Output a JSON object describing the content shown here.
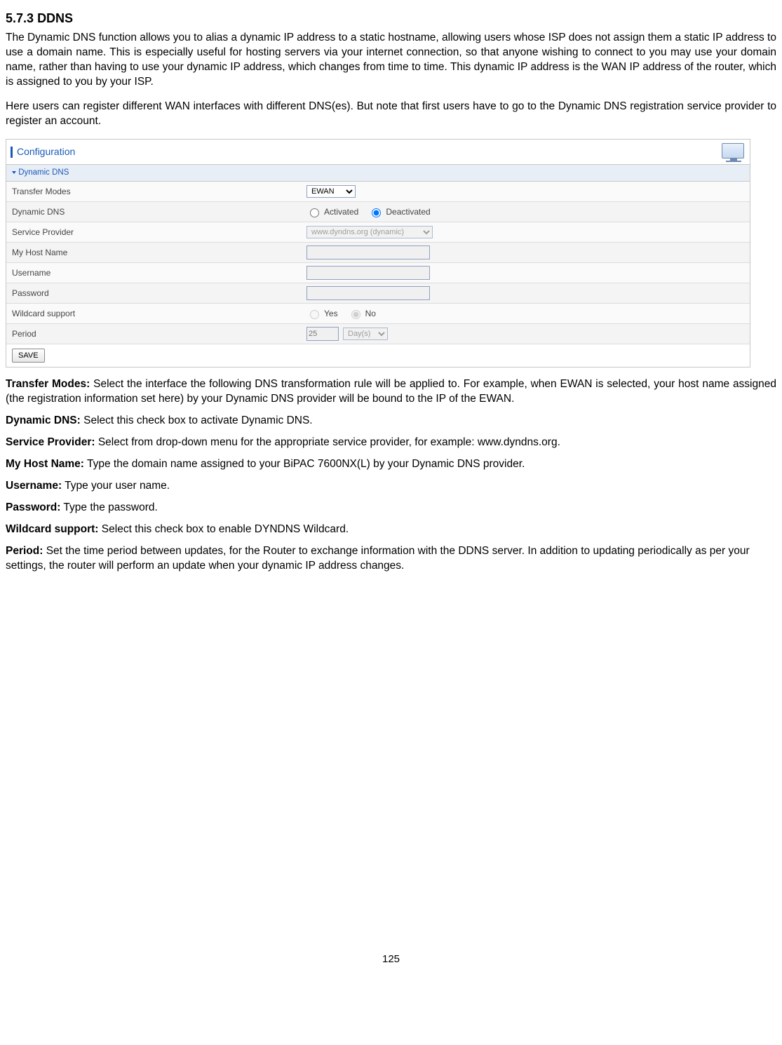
{
  "section": {
    "number": "5.7.3",
    "title": "DDNS"
  },
  "intro_para1": "The Dynamic DNS function allows you to alias a dynamic IP address to a static hostname, allowing users whose ISP does not assign them a static IP address to use a domain name. This is especially useful for hosting servers via your internet connection, so that anyone wishing to connect to you may use your domain name, rather than having to use your dynamic IP address, which changes from time to time. This dynamic IP address is the WAN IP address of the router, which is assigned to you by your ISP.",
  "intro_para2": "Here users can register different WAN interfaces with different DNS(es). But note that first users have to go to the Dynamic DNS registration service provider to register an account.",
  "cfg": {
    "header_title": "Configuration",
    "section_title": "Dynamic DNS",
    "rows": {
      "transfer_modes": {
        "label": "Transfer Modes",
        "value": "EWAN"
      },
      "dynamic_dns": {
        "label": "Dynamic DNS",
        "opt1": "Activated",
        "opt2": "Deactivated"
      },
      "service_provider": {
        "label": "Service Provider",
        "value": "www.dyndns.org (dynamic)"
      },
      "my_host_name": {
        "label": "My Host Name",
        "value": ""
      },
      "username": {
        "label": "Username",
        "value": ""
      },
      "password": {
        "label": "Password",
        "value": ""
      },
      "wildcard": {
        "label": "Wildcard support",
        "opt1": "Yes",
        "opt2": "No"
      },
      "period": {
        "label": "Period",
        "value": "25",
        "unit": "Day(s)"
      }
    },
    "save_label": "SAVE"
  },
  "defs": {
    "transfer_modes": {
      "term": "Transfer Modes:",
      "text": " Select the interface the following DNS transformation rule will be applied to. For example, when EWAN is selected, your host name assigned (the registration information set here) by your Dynamic DNS provider will be bound to the IP of the EWAN."
    },
    "dynamic_dns": {
      "term": "Dynamic DNS:",
      "text": " Select this check box to activate Dynamic DNS."
    },
    "service_provider": {
      "term": "Service Provider:",
      "text": " Select from drop-down menu for the appropriate service provider, for example: www.dyndns.org."
    },
    "my_host_name": {
      "term": "My Host Name:",
      "text": " Type the domain name assigned to your BiPAC 7600NX(L) by your Dynamic DNS provider."
    },
    "username": {
      "term": "Username:",
      "text": " Type your user name."
    },
    "password": {
      "term": "Password:",
      "text": " Type the password."
    },
    "wildcard": {
      "term": "Wildcard support:",
      "text": " Select this check box to enable DYNDNS Wildcard."
    },
    "period": {
      "term": "Period:",
      "text": " Set the time period between updates, for the Router to exchange information with the DDNS server. In addition to updating periodically as per your settings, the router will perform an update when your dynamic IP address changes."
    }
  },
  "page_number": "125"
}
